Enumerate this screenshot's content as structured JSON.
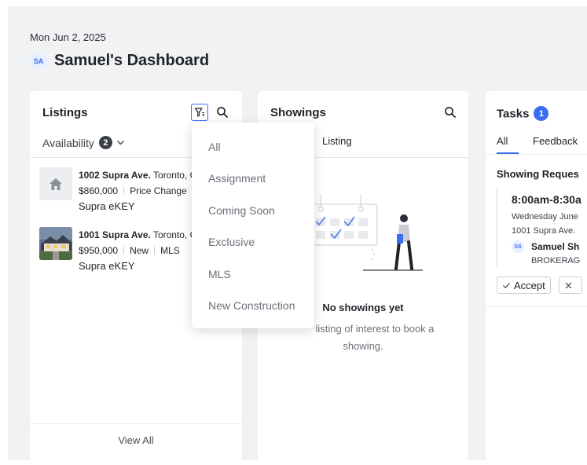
{
  "header": {
    "date": "Mon Jun 2, 2025",
    "avatar_initials": "SA",
    "title": "Samuel's Dashboard"
  },
  "listings": {
    "title": "Listings",
    "filter_label": "Availability",
    "filter_count": "2",
    "items": [
      {
        "address": "1002 Supra Ave.",
        "city": "Toronto, C",
        "price": "$860,000",
        "tags": [
          "Price Change"
        ],
        "ekey": "Supra eKEY",
        "thumb": "house-placeholder-icon"
      },
      {
        "address": "1001 Supra Ave.",
        "city": "Toronto, C",
        "price": "$950,000",
        "tags": [
          "New",
          "MLS"
        ],
        "ekey": "Supra eKEY",
        "thumb": "house-photo"
      }
    ],
    "view_all": "View All"
  },
  "filter_menu": {
    "options": [
      "All",
      "Assignment",
      "Coming Soon",
      "Exclusive",
      "MLS",
      "New Construction"
    ]
  },
  "showings": {
    "title": "Showings",
    "tab_visible": "Listing",
    "empty_title": "No showings yet",
    "empty_msg_line1": "listing of interest to book a",
    "empty_msg_line2": "showing."
  },
  "tasks": {
    "title": "Tasks",
    "count": "1",
    "tabs": [
      "All",
      "Feedback"
    ],
    "section": "Showing Reques",
    "request": {
      "time": "8:00am-8:30a",
      "date": "Wednesday June",
      "address": "1001 Supra Ave.",
      "agent_initials": "SS",
      "agent": "Samuel Sh",
      "brokerage": "BROKERAG"
    },
    "accept_label": "Accept"
  },
  "colors": {
    "accent": "#3a6df0",
    "background": "#f1f2f4",
    "card": "#ffffff"
  }
}
